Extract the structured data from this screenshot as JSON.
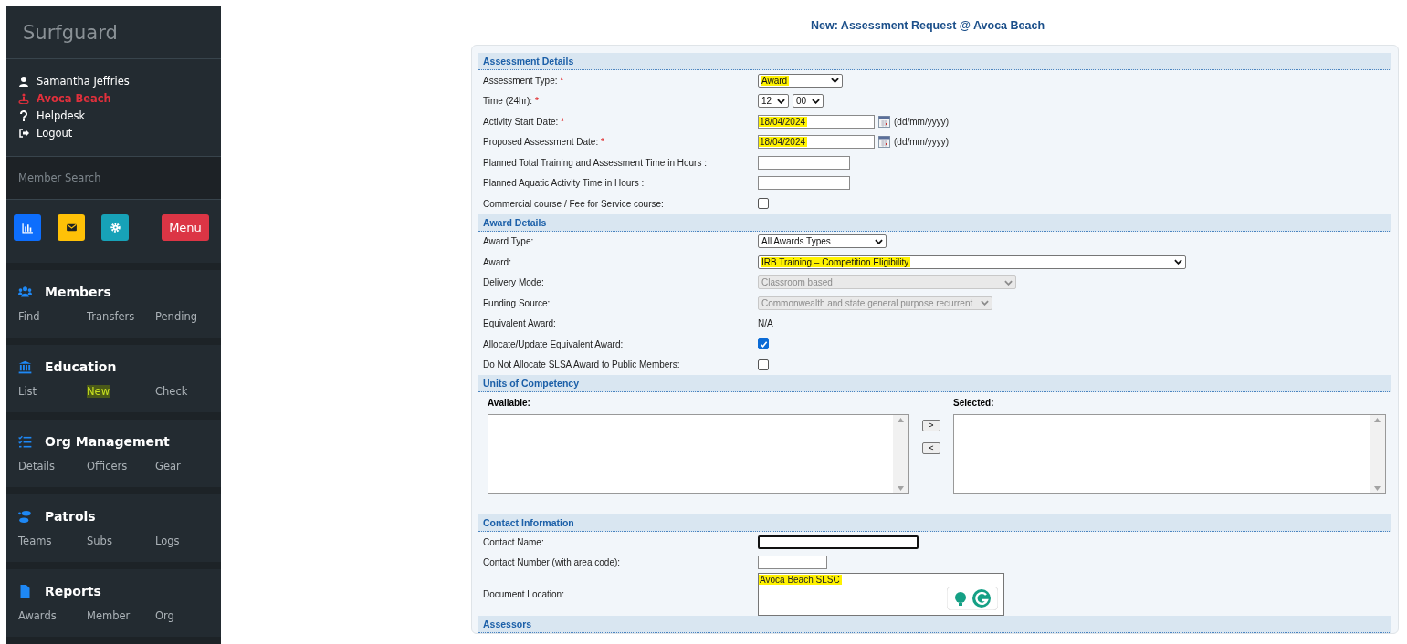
{
  "sidebar": {
    "brand": "Surfguard",
    "user_items": [
      {
        "label": "Samantha Jeffries",
        "active": false
      },
      {
        "label": "Avoca Beach",
        "active": true
      },
      {
        "label": "Helpdesk",
        "active": false
      },
      {
        "label": "Logout",
        "active": false
      }
    ],
    "search": {
      "placeholder": "Member Search"
    },
    "quick_buttons": [
      {
        "kind": "icon",
        "color": "#0d6efd"
      },
      {
        "kind": "icon",
        "color": "#ffc107"
      },
      {
        "kind": "icon",
        "color": "#17a2b8"
      },
      {
        "kind": "text",
        "label": "Menu",
        "color": "#dc3545"
      }
    ],
    "groups": [
      {
        "title": "Members",
        "links": [
          {
            "label": "Find",
            "highlighted": false
          },
          {
            "label": "Transfers",
            "highlighted": false
          },
          {
            "label": "Pending",
            "highlighted": false
          }
        ]
      },
      {
        "title": "Education",
        "links": [
          {
            "label": "List",
            "highlighted": false
          },
          {
            "label": "New",
            "highlighted": true
          },
          {
            "label": "Check",
            "highlighted": false
          }
        ]
      },
      {
        "title": "Org Management",
        "links": [
          {
            "label": "Details",
            "highlighted": false
          },
          {
            "label": "Officers",
            "highlighted": false
          },
          {
            "label": "Gear",
            "highlighted": false
          }
        ]
      },
      {
        "title": "Patrols",
        "links": [
          {
            "label": "Teams",
            "highlighted": false
          },
          {
            "label": "Subs",
            "highlighted": false
          },
          {
            "label": "Logs",
            "highlighted": false
          }
        ]
      },
      {
        "title": "Reports",
        "links": [
          {
            "label": "Awards",
            "highlighted": false
          },
          {
            "label": "Member",
            "highlighted": false
          },
          {
            "label": "Org",
            "highlighted": false
          }
        ]
      }
    ]
  },
  "page_title": "New: Assessment Request @ Avoca Beach",
  "sections": [
    {
      "title": "Assessment Details",
      "kind": "rows",
      "rows": [
        {
          "kind": "select",
          "label": "Assessment Type:",
          "required_mark": "*",
          "value": "Award",
          "disabled": false,
          "highlighted": true
        },
        {
          "kind": "time",
          "label": "Time (24hr):",
          "required_mark": "*",
          "hour": "12",
          "minute": "00"
        },
        {
          "kind": "date",
          "label": "Activity Start Date:",
          "required_mark": "*",
          "value": "18/04/2024",
          "hint": "(dd/mm/yyyy)",
          "highlighted": true
        },
        {
          "kind": "date",
          "label": "Proposed Assessment Date:",
          "required_mark": "*",
          "value": "18/04/2024",
          "hint": "(dd/mm/yyyy)",
          "highlighted": true
        },
        {
          "kind": "text",
          "label": "Planned Total Training and Assessment Time in Hours :"
        },
        {
          "kind": "text",
          "label": "Planned Aquatic Activity Time in Hours :"
        },
        {
          "kind": "checkbox",
          "label": "Commercial course / Fee for Service course:",
          "checked": false
        }
      ]
    },
    {
      "title": "Award Details",
      "kind": "rows",
      "rows": [
        {
          "kind": "select",
          "label": "Award Type:",
          "value": "All Awards Types",
          "disabled": false,
          "highlighted": false
        },
        {
          "kind": "select",
          "label": "Award:",
          "value": "IRB Training – Competition Eligibility",
          "disabled": false,
          "highlighted": true
        },
        {
          "kind": "select",
          "label": "Delivery Mode:",
          "value": "Classroom based",
          "disabled": true,
          "highlighted": false
        },
        {
          "kind": "select",
          "label": "Funding Source:",
          "value": "Commonwealth and state general purpose recurrent",
          "disabled": true,
          "highlighted": false
        },
        {
          "kind": "static",
          "label": "Equivalent Award:",
          "value": "N/A"
        },
        {
          "kind": "checkbox",
          "label": "Allocate/Update Equivalent Award:",
          "checked": true
        },
        {
          "kind": "checkbox",
          "label": "Do Not Allocate SLSA Award to Public Members:",
          "checked": false
        }
      ]
    },
    {
      "title": "Units of Competency",
      "kind": "lists",
      "available_label": "Available:",
      "selected_label": "Selected:",
      "add_button": ">",
      "remove_button": "<"
    },
    {
      "title": "Contact Information",
      "kind": "rows",
      "rows": [
        {
          "kind": "text",
          "label": "Contact Name:",
          "focused": true
        },
        {
          "kind": "text",
          "label": "Contact Number (with area code):",
          "focused": false
        },
        {
          "kind": "textarea",
          "label": "Document Location:",
          "value": "Avoca Beach SLSC",
          "highlighted": true
        }
      ]
    },
    {
      "title": "Assessors",
      "kind": "header"
    }
  ]
}
